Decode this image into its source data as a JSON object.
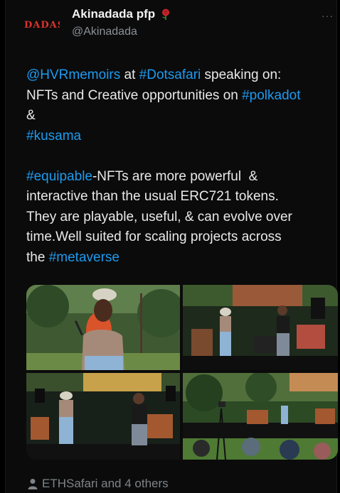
{
  "tweet": {
    "author_name": "Akinadada pfp",
    "author_handle": "@Akinadada",
    "avatar_text": "DADAS",
    "more_label": "···",
    "text_segments": [
      {
        "text": "@HVRmemoirs",
        "link": true
      },
      {
        "text": " at ",
        "link": false
      },
      {
        "text": "#Dotsafari",
        "link": true
      },
      {
        "text": " speaking on:\nNFTs and Creative opportunities on ",
        "link": false
      },
      {
        "text": "#polkadot",
        "link": true
      },
      {
        "text": "\n&\n",
        "link": false
      },
      {
        "text": "#kusama",
        "link": true
      },
      {
        "text": "\n\n",
        "link": false
      },
      {
        "text": "#equipable",
        "link": true
      },
      {
        "text": "-NFTs are more powerful  &\ninteractive than the usual ERC721 tokens.\nThey are playable, useful, & can evolve over\ntime.Well suited for scaling projects across\nthe ",
        "link": false
      },
      {
        "text": "#metaverse",
        "link": true
      }
    ],
    "liked_by": "ETHSafari and 4 others",
    "photos": [
      {
        "name": "photo-speaker-closeup"
      },
      {
        "name": "photo-stage-two-speakers"
      },
      {
        "name": "photo-stage-wide"
      },
      {
        "name": "photo-audience-view"
      }
    ]
  },
  "colors": {
    "link": "#1d9bf0",
    "background": "#0b0b0b",
    "text": "#e9e9e9",
    "muted": "#7d8489"
  },
  "icons": [
    "rose-icon",
    "more-icon",
    "person-icon"
  ]
}
